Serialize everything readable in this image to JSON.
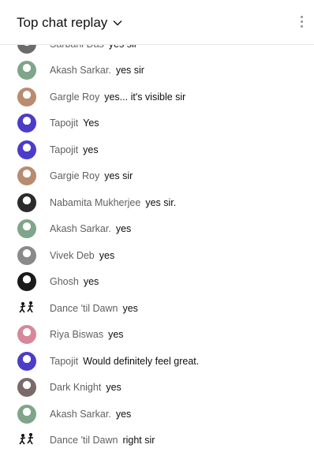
{
  "header": {
    "title": "Top chat replay"
  },
  "messages": [
    {
      "author": "Sarbani Das",
      "text": "yes sir",
      "avatar": "grey-photo"
    },
    {
      "author": "Akash Sarkar.",
      "text": "yes sir",
      "avatar": "green-photo"
    },
    {
      "author": "Gargle Roy",
      "text": "yes... it's visible sir",
      "avatar": "face-photo"
    },
    {
      "author": "Tapojit",
      "text": "Yes",
      "avatar": "purple-photo"
    },
    {
      "author": "Tapojit",
      "text": "yes",
      "avatar": "purple-photo"
    },
    {
      "author": "Gargie Roy",
      "text": "yes sir",
      "avatar": "face-photo"
    },
    {
      "author": "Nabamita Mukherjee",
      "text": "yes sir.",
      "avatar": "dark-photo"
    },
    {
      "author": "Akash Sarkar.",
      "text": "yes",
      "avatar": "green-photo"
    },
    {
      "author": "Vivek Deb",
      "text": "yes",
      "avatar": "figure-photo"
    },
    {
      "author": "Ghosh",
      "text": "yes",
      "avatar": "black-photo"
    },
    {
      "author": "Dance 'til Dawn",
      "text": "yes",
      "avatar": "dancer-icon"
    },
    {
      "author": "Riya Biswas",
      "text": "yes",
      "avatar": "pink-photo"
    },
    {
      "author": "Tapojit",
      "text": "Would definitely feel great.",
      "avatar": "purple-photo"
    },
    {
      "author": "Dark Knight",
      "text": "yes",
      "avatar": "brown-photo"
    },
    {
      "author": "Akash Sarkar.",
      "text": "yes",
      "avatar": "green-photo"
    },
    {
      "author": "Dance 'til Dawn",
      "text": "right sir",
      "avatar": "dancer-icon"
    }
  ],
  "colors": {
    "author": "#606060",
    "text": "#0f0f0f",
    "grey-photo": "#6b6b6b",
    "green-photo": "#7fa58a",
    "face-photo": "#b98b6f",
    "purple-photo": "#4b3cc9",
    "dark-photo": "#2b2b2b",
    "figure-photo": "#8a8a8a",
    "black-photo": "#1a1a1a",
    "pink-photo": "#d6889a",
    "brown-photo": "#7a6a6a"
  }
}
